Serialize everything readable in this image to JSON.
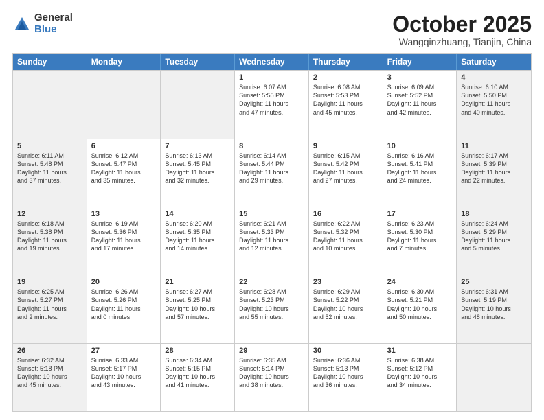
{
  "logo": {
    "general": "General",
    "blue": "Blue"
  },
  "title": "October 2025",
  "subtitle": "Wangqinzhuang, Tianjin, China",
  "header_days": [
    "Sunday",
    "Monday",
    "Tuesday",
    "Wednesday",
    "Thursday",
    "Friday",
    "Saturday"
  ],
  "rows": [
    [
      {
        "day": "",
        "info": "",
        "shaded": true
      },
      {
        "day": "",
        "info": "",
        "shaded": true
      },
      {
        "day": "",
        "info": "",
        "shaded": true
      },
      {
        "day": "1",
        "info": "Sunrise: 6:07 AM\nSunset: 5:55 PM\nDaylight: 11 hours\nand 47 minutes.",
        "shaded": false
      },
      {
        "day": "2",
        "info": "Sunrise: 6:08 AM\nSunset: 5:53 PM\nDaylight: 11 hours\nand 45 minutes.",
        "shaded": false
      },
      {
        "day": "3",
        "info": "Sunrise: 6:09 AM\nSunset: 5:52 PM\nDaylight: 11 hours\nand 42 minutes.",
        "shaded": false
      },
      {
        "day": "4",
        "info": "Sunrise: 6:10 AM\nSunset: 5:50 PM\nDaylight: 11 hours\nand 40 minutes.",
        "shaded": true
      }
    ],
    [
      {
        "day": "5",
        "info": "Sunrise: 6:11 AM\nSunset: 5:48 PM\nDaylight: 11 hours\nand 37 minutes.",
        "shaded": true
      },
      {
        "day": "6",
        "info": "Sunrise: 6:12 AM\nSunset: 5:47 PM\nDaylight: 11 hours\nand 35 minutes.",
        "shaded": false
      },
      {
        "day": "7",
        "info": "Sunrise: 6:13 AM\nSunset: 5:45 PM\nDaylight: 11 hours\nand 32 minutes.",
        "shaded": false
      },
      {
        "day": "8",
        "info": "Sunrise: 6:14 AM\nSunset: 5:44 PM\nDaylight: 11 hours\nand 29 minutes.",
        "shaded": false
      },
      {
        "day": "9",
        "info": "Sunrise: 6:15 AM\nSunset: 5:42 PM\nDaylight: 11 hours\nand 27 minutes.",
        "shaded": false
      },
      {
        "day": "10",
        "info": "Sunrise: 6:16 AM\nSunset: 5:41 PM\nDaylight: 11 hours\nand 24 minutes.",
        "shaded": false
      },
      {
        "day": "11",
        "info": "Sunrise: 6:17 AM\nSunset: 5:39 PM\nDaylight: 11 hours\nand 22 minutes.",
        "shaded": true
      }
    ],
    [
      {
        "day": "12",
        "info": "Sunrise: 6:18 AM\nSunset: 5:38 PM\nDaylight: 11 hours\nand 19 minutes.",
        "shaded": true
      },
      {
        "day": "13",
        "info": "Sunrise: 6:19 AM\nSunset: 5:36 PM\nDaylight: 11 hours\nand 17 minutes.",
        "shaded": false
      },
      {
        "day": "14",
        "info": "Sunrise: 6:20 AM\nSunset: 5:35 PM\nDaylight: 11 hours\nand 14 minutes.",
        "shaded": false
      },
      {
        "day": "15",
        "info": "Sunrise: 6:21 AM\nSunset: 5:33 PM\nDaylight: 11 hours\nand 12 minutes.",
        "shaded": false
      },
      {
        "day": "16",
        "info": "Sunrise: 6:22 AM\nSunset: 5:32 PM\nDaylight: 11 hours\nand 10 minutes.",
        "shaded": false
      },
      {
        "day": "17",
        "info": "Sunrise: 6:23 AM\nSunset: 5:30 PM\nDaylight: 11 hours\nand 7 minutes.",
        "shaded": false
      },
      {
        "day": "18",
        "info": "Sunrise: 6:24 AM\nSunset: 5:29 PM\nDaylight: 11 hours\nand 5 minutes.",
        "shaded": true
      }
    ],
    [
      {
        "day": "19",
        "info": "Sunrise: 6:25 AM\nSunset: 5:27 PM\nDaylight: 11 hours\nand 2 minutes.",
        "shaded": true
      },
      {
        "day": "20",
        "info": "Sunrise: 6:26 AM\nSunset: 5:26 PM\nDaylight: 11 hours\nand 0 minutes.",
        "shaded": false
      },
      {
        "day": "21",
        "info": "Sunrise: 6:27 AM\nSunset: 5:25 PM\nDaylight: 10 hours\nand 57 minutes.",
        "shaded": false
      },
      {
        "day": "22",
        "info": "Sunrise: 6:28 AM\nSunset: 5:23 PM\nDaylight: 10 hours\nand 55 minutes.",
        "shaded": false
      },
      {
        "day": "23",
        "info": "Sunrise: 6:29 AM\nSunset: 5:22 PM\nDaylight: 10 hours\nand 52 minutes.",
        "shaded": false
      },
      {
        "day": "24",
        "info": "Sunrise: 6:30 AM\nSunset: 5:21 PM\nDaylight: 10 hours\nand 50 minutes.",
        "shaded": false
      },
      {
        "day": "25",
        "info": "Sunrise: 6:31 AM\nSunset: 5:19 PM\nDaylight: 10 hours\nand 48 minutes.",
        "shaded": true
      }
    ],
    [
      {
        "day": "26",
        "info": "Sunrise: 6:32 AM\nSunset: 5:18 PM\nDaylight: 10 hours\nand 45 minutes.",
        "shaded": true
      },
      {
        "day": "27",
        "info": "Sunrise: 6:33 AM\nSunset: 5:17 PM\nDaylight: 10 hours\nand 43 minutes.",
        "shaded": false
      },
      {
        "day": "28",
        "info": "Sunrise: 6:34 AM\nSunset: 5:15 PM\nDaylight: 10 hours\nand 41 minutes.",
        "shaded": false
      },
      {
        "day": "29",
        "info": "Sunrise: 6:35 AM\nSunset: 5:14 PM\nDaylight: 10 hours\nand 38 minutes.",
        "shaded": false
      },
      {
        "day": "30",
        "info": "Sunrise: 6:36 AM\nSunset: 5:13 PM\nDaylight: 10 hours\nand 36 minutes.",
        "shaded": false
      },
      {
        "day": "31",
        "info": "Sunrise: 6:38 AM\nSunset: 5:12 PM\nDaylight: 10 hours\nand 34 minutes.",
        "shaded": false
      },
      {
        "day": "",
        "info": "",
        "shaded": true
      }
    ]
  ]
}
